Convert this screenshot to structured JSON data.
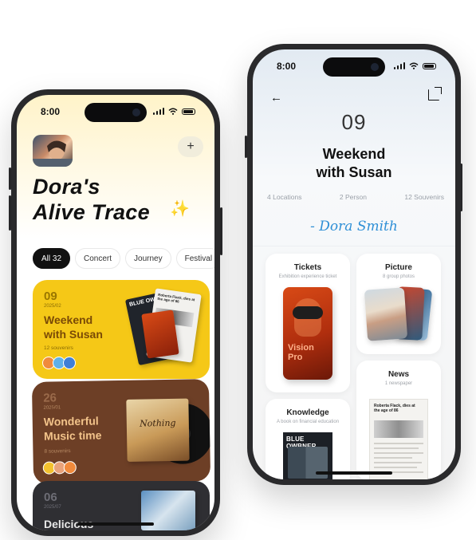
{
  "left_phone": {
    "status": {
      "time": "8:00"
    },
    "add_label": "+",
    "title_line1": "Dora's",
    "title_line2": "Alive Trace",
    "sparkle": "✨",
    "chips": [
      "All 32",
      "Concert",
      "Journey",
      "Festival"
    ],
    "cards": [
      {
        "num": "09",
        "date": "2025/02",
        "title_line1": "Weekend",
        "title_line2": "with Susan",
        "sub": "12 souvenirs",
        "color": "#f5c817",
        "poster1_title": "BLUE OWBNER",
        "poster2_title": "Roberta Flack, dies at the age of 86"
      },
      {
        "num": "26",
        "date": "2025/01",
        "title_line1": "Wonderful",
        "title_line2": "Music time",
        "sub": "8 souvenirs",
        "color": "#6d3f26",
        "album_title": "Nothing"
      },
      {
        "num": "06",
        "date": "2025/07",
        "title": "Delicious",
        "color": "#2f2f33"
      }
    ]
  },
  "right_phone": {
    "status": {
      "time": "8:00"
    },
    "back_icon": "←",
    "number": "09",
    "title_line1": "Weekend",
    "title_line2": "with Susan",
    "stats": [
      "4 Locations",
      "2 Person",
      "12 Souvenirs"
    ],
    "signature": "- Dora Smith",
    "tiles": {
      "tickets": {
        "title": "Tickets",
        "sub": "Exhibition experience ticket",
        "poster_text_1": "Vision",
        "poster_text_2": "Pro"
      },
      "picture": {
        "title": "Picture",
        "sub": "8 group photos"
      },
      "news": {
        "title": "News",
        "sub": "1 newspaper",
        "headline": "Roberta Flack, dies at the age of 86"
      },
      "knowledge": {
        "title": "Knowledge",
        "sub": "A book on financial education",
        "book_title": "BLUE OWBNER"
      }
    }
  }
}
